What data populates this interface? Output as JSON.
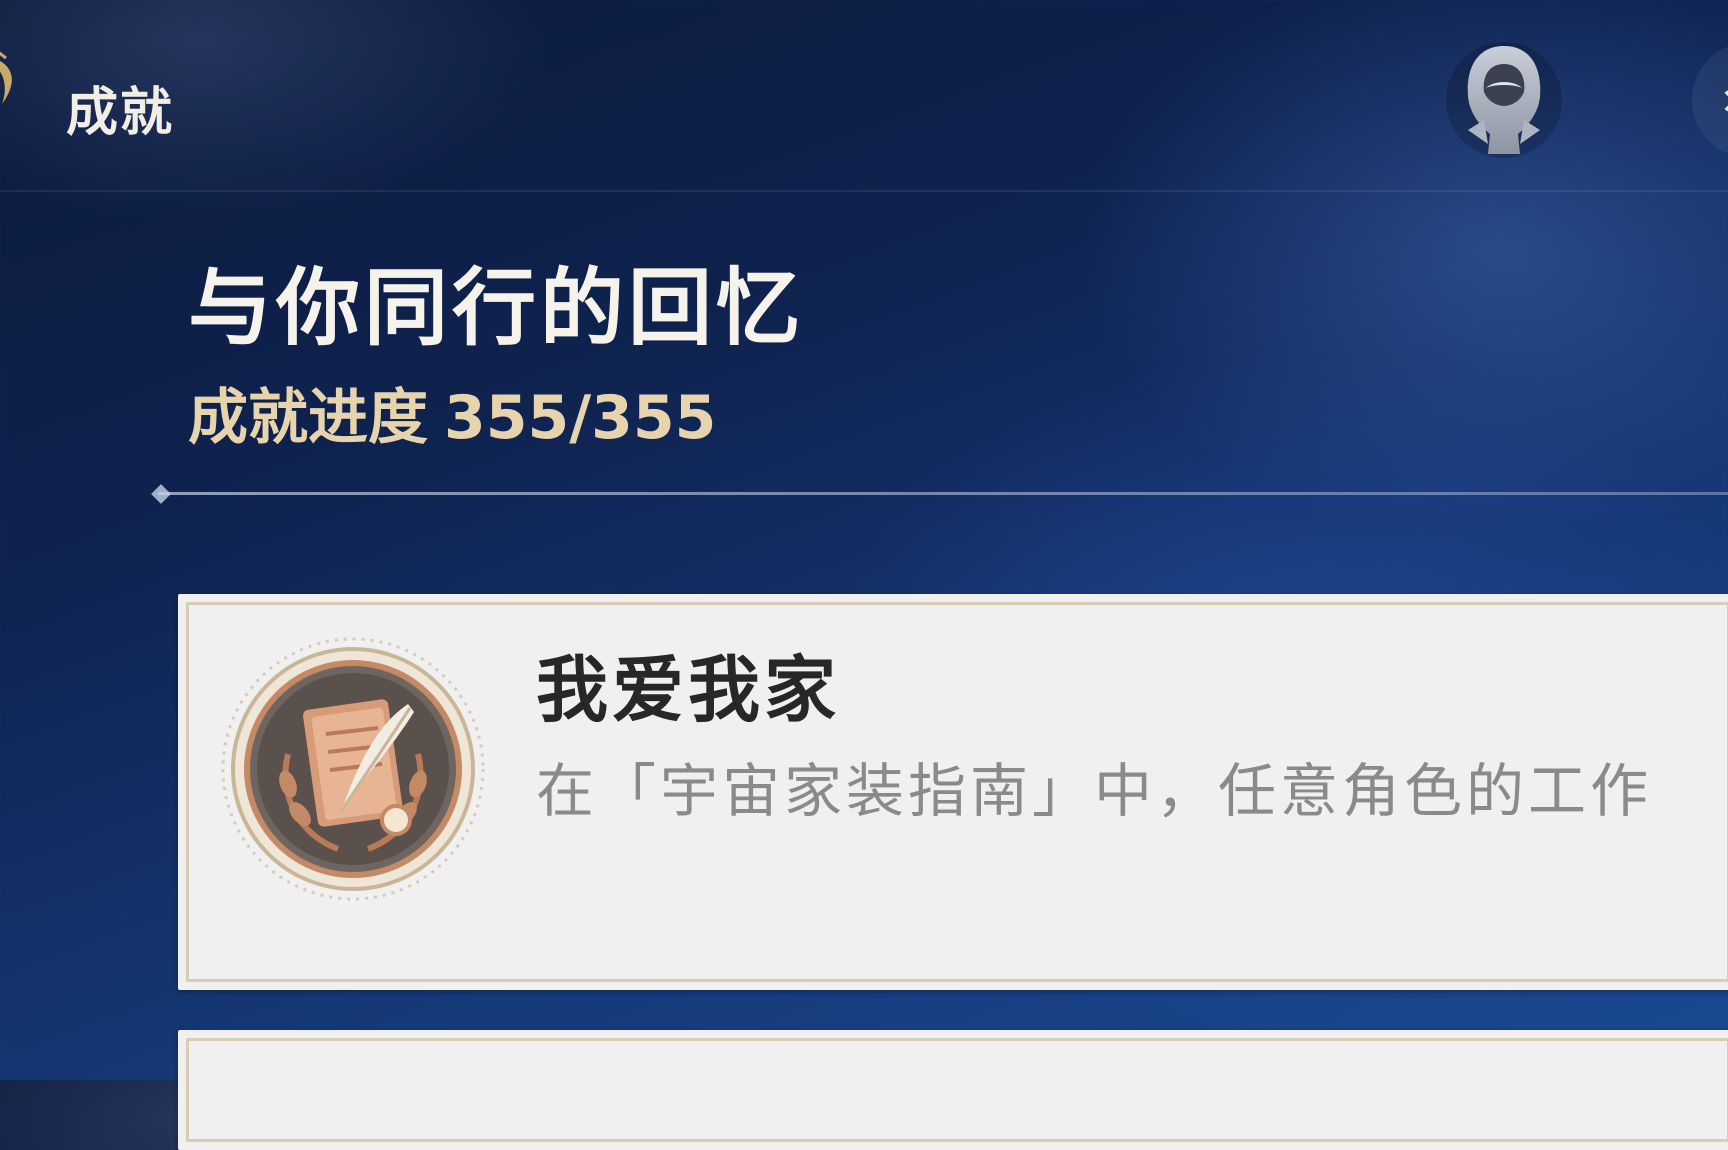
{
  "header": {
    "title": "成就",
    "back_icon": "wing-emblem-icon",
    "badge_icon": "hooded-emblem-icon",
    "close_icon": "close-icon"
  },
  "series": {
    "title": "与你同行的回忆",
    "progress_label": "成就进度",
    "progress_value": "355/355",
    "progress_fraction": 1.0
  },
  "achievements": [
    {
      "name": "我爱我家",
      "description": "在「宇宙家装指南」中，任意角色的工作",
      "icon": "quill-notebook-medal-icon"
    },
    {
      "name": "",
      "description": "",
      "icon": ""
    }
  ],
  "colors": {
    "progress_text": "#e7d3ac",
    "card_bg": "#f0f0f0",
    "card_border": "#d9ccb7",
    "medal_bronze": "#c48a66"
  }
}
